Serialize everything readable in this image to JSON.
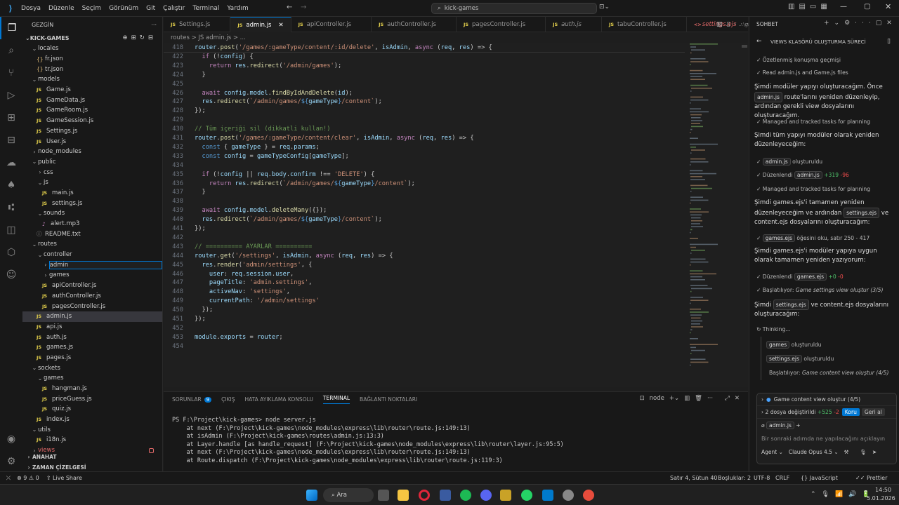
{
  "menu": [
    "Dosya",
    "Düzenle",
    "Seçim",
    "Görünüm",
    "Git",
    "Çalıştır",
    "Terminal",
    "Yardım"
  ],
  "search": "kick-games",
  "explorer": {
    "title": "GEZGİN",
    "project": "KICK-GAMES"
  },
  "tree": [
    {
      "t": "locales",
      "d": 1,
      "k": "open"
    },
    {
      "t": "fr.json",
      "d": 2,
      "k": "json"
    },
    {
      "t": "tr.json",
      "d": 2,
      "k": "json"
    },
    {
      "t": "models",
      "d": 1,
      "k": "open"
    },
    {
      "t": "Game.js",
      "d": 2,
      "k": "js"
    },
    {
      "t": "GameData.js",
      "d": 2,
      "k": "js"
    },
    {
      "t": "GameRoom.js",
      "d": 2,
      "k": "js"
    },
    {
      "t": "GameSession.js",
      "d": 2,
      "k": "js"
    },
    {
      "t": "Settings.js",
      "d": 2,
      "k": "js"
    },
    {
      "t": "User.js",
      "d": 2,
      "k": "js"
    },
    {
      "t": "node_modules",
      "d": 1,
      "k": "closed"
    },
    {
      "t": "public",
      "d": 1,
      "k": "open"
    },
    {
      "t": "css",
      "d": 2,
      "k": "closed"
    },
    {
      "t": "js",
      "d": 2,
      "k": "open"
    },
    {
      "t": "main.js",
      "d": 3,
      "k": "js"
    },
    {
      "t": "settings.js",
      "d": 3,
      "k": "js"
    },
    {
      "t": "sounds",
      "d": 2,
      "k": "open"
    },
    {
      "t": "alert.mp3",
      "d": 3,
      "k": "audio"
    },
    {
      "t": "README.txt",
      "d": 2,
      "k": "txt"
    },
    {
      "t": "routes",
      "d": 1,
      "k": "open"
    },
    {
      "t": "controller",
      "d": 2,
      "k": "open"
    },
    {
      "t": "admin",
      "d": 3,
      "k": "edit"
    },
    {
      "t": "games",
      "d": 3,
      "k": "closed"
    },
    {
      "t": "apiController.js",
      "d": 3,
      "k": "js"
    },
    {
      "t": "authController.js",
      "d": 3,
      "k": "js"
    },
    {
      "t": "pagesController.js",
      "d": 3,
      "k": "js"
    },
    {
      "t": "admin.js",
      "d": 2,
      "k": "jssel"
    },
    {
      "t": "api.js",
      "d": 2,
      "k": "js"
    },
    {
      "t": "auth.js",
      "d": 2,
      "k": "js"
    },
    {
      "t": "games.js",
      "d": 2,
      "k": "js"
    },
    {
      "t": "pages.js",
      "d": 2,
      "k": "js"
    },
    {
      "t": "sockets",
      "d": 1,
      "k": "open"
    },
    {
      "t": "games",
      "d": 2,
      "k": "open"
    },
    {
      "t": "hangman.js",
      "d": 3,
      "k": "js"
    },
    {
      "t": "priceGuess.js",
      "d": 3,
      "k": "js"
    },
    {
      "t": "quiz.js",
      "d": 3,
      "k": "js"
    },
    {
      "t": "index.js",
      "d": 2,
      "k": "js"
    },
    {
      "t": "utils",
      "d": 1,
      "k": "open"
    },
    {
      "t": "i18n.js",
      "d": 2,
      "k": "js"
    },
    {
      "t": "views",
      "d": 1,
      "k": "views"
    }
  ],
  "outline": [
    "ANAHAT",
    "ZAMAN ÇİZELGESİ"
  ],
  "tabs": [
    {
      "t": "Settings.js",
      "a": false
    },
    {
      "t": "admin.js",
      "a": true
    },
    {
      "t": "apiController.js",
      "a": false
    },
    {
      "t": "authController.js",
      "a": false
    },
    {
      "t": "pagesController.js",
      "a": false
    },
    {
      "t": "auth.js",
      "a": false,
      "i": true
    },
    {
      "t": "tabuController.js",
      "a": false
    },
    {
      "t": "settings.ejs",
      "a": false,
      "i": true,
      "extra": "...\\games"
    }
  ],
  "breadcrumb": "routes > JS admin.js > ...",
  "code": [
    [
      "418",
      "router.post('/games/:gameType/content/:id/delete', isAdmin, async (req, res) => {"
    ],
    [
      "422",
      "  if (!config) {"
    ],
    [
      "423",
      "    return res.redirect('/admin/games');"
    ],
    [
      "424",
      "  }"
    ],
    [
      "425",
      ""
    ],
    [
      "426",
      "  await config.model.findByIdAndDelete(id);"
    ],
    [
      "427",
      "  res.redirect(`/admin/games/${gameType}/content`);"
    ],
    [
      "428",
      "});"
    ],
    [
      "429",
      ""
    ],
    [
      "430",
      "// Tüm içeriği sil (dikkatli kullan!)"
    ],
    [
      "431",
      "router.post('/games/:gameType/content/clear', isAdmin, async (req, res) => {"
    ],
    [
      "432",
      "  const { gameType } = req.params;"
    ],
    [
      "433",
      "  const config = gameTypeConfig[gameType];"
    ],
    [
      "434",
      ""
    ],
    [
      "435",
      "  if (!config || req.body.confirm !== 'DELETE') {"
    ],
    [
      "436",
      "    return res.redirect(`/admin/games/${gameType}/content`);"
    ],
    [
      "437",
      "  }"
    ],
    [
      "438",
      ""
    ],
    [
      "439",
      "  await config.model.deleteMany({});"
    ],
    [
      "440",
      "  res.redirect(`/admin/games/${gameType}/content`);"
    ],
    [
      "441",
      "});"
    ],
    [
      "442",
      ""
    ],
    [
      "443",
      "// ========== AYARLAR =========="
    ],
    [
      "444",
      "router.get('/settings', isAdmin, async (req, res) => {"
    ],
    [
      "445",
      "  res.render('admin/settings', {"
    ],
    [
      "446",
      "    user: req.session.user,"
    ],
    [
      "447",
      "    pageTitle: 'admin.settings',"
    ],
    [
      "448",
      "    activeNav: 'settings',"
    ],
    [
      "449",
      "    currentPath: '/admin/settings'"
    ],
    [
      "450",
      "  });"
    ],
    [
      "451",
      "});"
    ],
    [
      "452",
      ""
    ],
    [
      "453",
      "module.exports = router;"
    ],
    [
      "454",
      ""
    ]
  ],
  "panel": {
    "tabs": [
      "SORUNLAR",
      "ÇIKIŞ",
      "HATA AYIKLAMA KONSOLU",
      "TERMINAL",
      "BAĞLANTI NOKTALARI"
    ],
    "problems": "9",
    "shell": "node"
  },
  "terminal": [
    "PS F:\\Project\\kick-games> node server.js",
    "    at next (F:\\Project\\kick-games\\node_modules\\express\\lib\\router\\route.js:149:13)",
    "    at isAdmin (F:\\Project\\kick-games\\routes\\admin.js:13:3)",
    "    at Layer.handle [as handle_request] (F:\\Project\\kick-games\\node_modules\\express\\lib\\router\\layer.js:95:5)",
    "    at next (F:\\Project\\kick-games\\node_modules\\express\\lib\\router\\route.js:149:13)",
    "    at Route.dispatch (F:\\Project\\kick-games\\node_modules\\express\\lib\\router\\route.js:119:3)"
  ],
  "chat": {
    "header": "SOHBET",
    "title": "VIEWS KLASÖRÜ OLUŞTURMA SÜRECİ",
    "s1": "Özetlenmiş konuşma geçmişi",
    "s2": "Read admin.js and Game.js files",
    "p1a": "Şimdi modüler yapıyı oluşturacağım. Önce",
    "p1chip": "admin.js",
    "p1b": "route'larını yeniden düzenleyip, ardından gerekli view dosyalarını oluşturacağım.",
    "s3": "Managed and tracked tasks for planning",
    "p2": "Şimdi tüm yapıyı modüler olarak yeniden düzenleyeceğim:",
    "c1chip": "admin.js",
    "c1": "oluşturuldu",
    "c2": "Düzenlendi",
    "c2chip": "admin.js",
    "c2add": "+319",
    "c2del": "-96",
    "s4": "Managed and tracked tasks for planning",
    "p3a": "Şimdi games.ejs'i tamamen yeniden düzenleyeceğim ve ardından",
    "p3chip": "settings.ejs",
    "p3b": "ve content.ejs dosyalarını oluşturacağım:",
    "c3chip": "games.ejs",
    "c3": "öğesini oku, satır 250 - 417",
    "p4": "Şimdi games.ejs'i modüler yapıya uygun olarak tamamen yeniden yazıyorum:",
    "c4": "Düzenlendi",
    "c4chip": "games.ejs",
    "c4add": "+0",
    "c4del": "-0",
    "s5a": "Başlatılıyor:",
    "s5b": "Game settings view oluştur (3/5)",
    "p5a": "Şimdi",
    "p5chip": "settings.ejs",
    "p5b": "ve content.ejs dosyalarını oluşturacağım:",
    "thinking": "Thinking...",
    "t1chip": "games",
    "t1": "oluşturuldu",
    "t2chip": "settings.ejs",
    "t2": "oluşturuldu",
    "t3a": "Başlatılıyor:",
    "t3b": "Game content view oluştur (4/5)",
    "task": "Game content view oluştur (4/5)",
    "changed": "2 dosya değiştirildi",
    "cadd": "+525",
    "cdel": "-2",
    "keep": "Koru",
    "undo": "Geri al",
    "ctxchip": "admin.js",
    "placeholder": "Bir sonraki adımda ne yapılacağını açıklayın",
    "agent": "Agent",
    "model": "Claude Opus 4.5"
  },
  "status": {
    "errors": "9",
    "warnings": "0",
    "live": "Live Share",
    "pos": "Satır 4, Sütun 40",
    "spaces": "Boşluklar: 2",
    "enc": "UTF-8",
    "eol": "CRLF",
    "lang": "JavaScript",
    "prettier": "Prettier"
  },
  "taskbar": {
    "search": "Ara",
    "time": "14:50",
    "date": "5.01.2026"
  }
}
